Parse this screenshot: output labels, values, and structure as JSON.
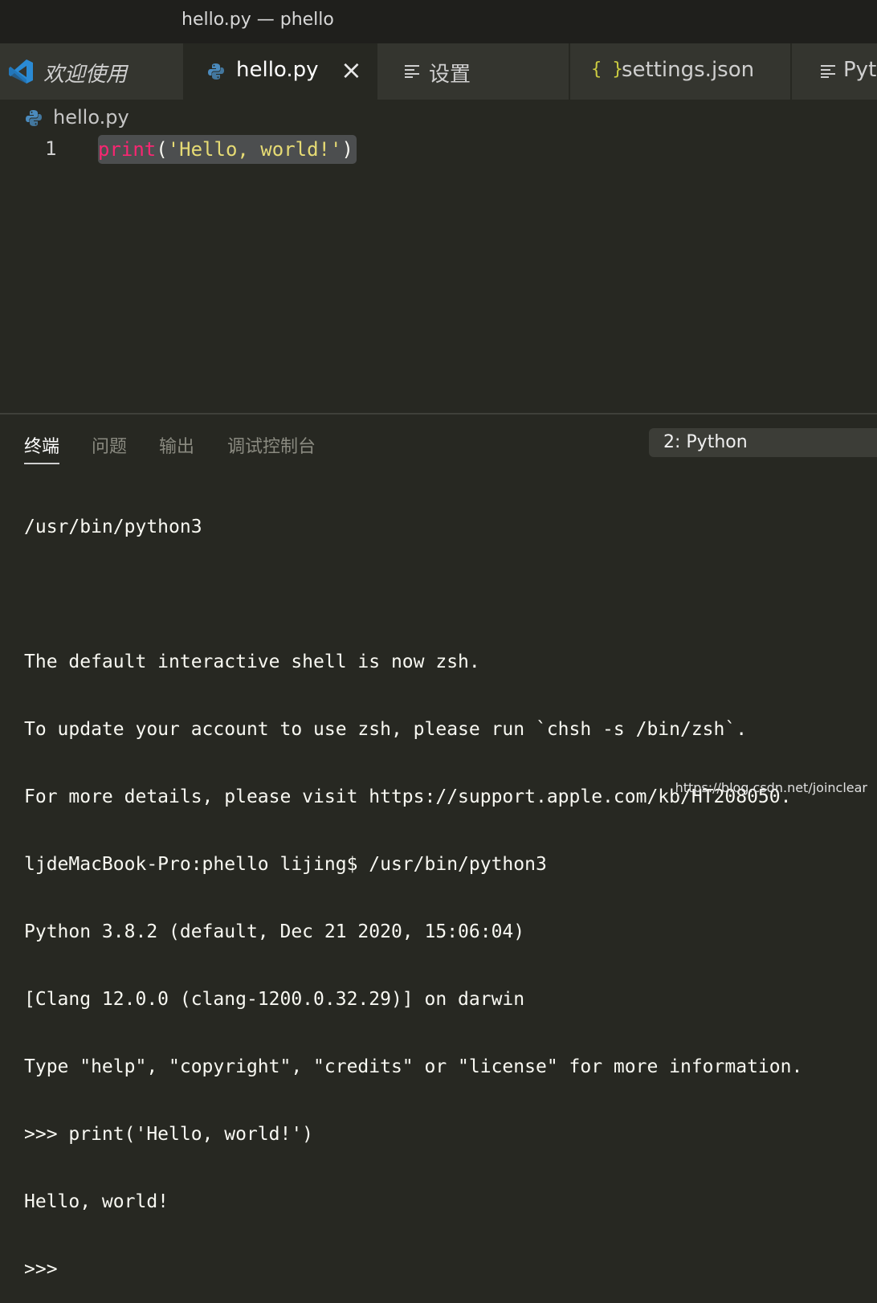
{
  "window": {
    "title": "hello.py — phello"
  },
  "tabs": [
    {
      "label": "欢迎使用",
      "icon": "vscode-logo-icon",
      "active": false
    },
    {
      "label": "hello.py",
      "icon": "python-file-icon",
      "active": true,
      "close": "×"
    },
    {
      "label": "设置",
      "icon": "settings-lines-icon",
      "active": false
    },
    {
      "label": "settings.json",
      "icon": "json-braces-icon",
      "icon_glyph": "{ }",
      "active": false
    },
    {
      "label": "Pyt",
      "icon": "settings-lines-icon",
      "active": false
    }
  ],
  "breadcrumb": {
    "file": "hello.py",
    "icon": "python-file-icon"
  },
  "editor": {
    "lines": [
      {
        "number": "1",
        "tokens": {
          "func": "print",
          "open": "(",
          "str": "'Hello, world!'",
          "close": ")"
        }
      }
    ]
  },
  "panel": {
    "tabs": [
      {
        "label": "终端",
        "active": true
      },
      {
        "label": "问题",
        "active": false
      },
      {
        "label": "输出",
        "active": false
      },
      {
        "label": "调试控制台",
        "active": false
      }
    ],
    "terminal_selector": "2: Python"
  },
  "terminal": {
    "lines": [
      "/usr/bin/python3",
      "",
      "The default interactive shell is now zsh.",
      "To update your account to use zsh, please run `chsh -s /bin/zsh`.",
      "For more details, please visit https://support.apple.com/kb/HT208050.",
      "ljdeMacBook-Pro:phello lijing$ /usr/bin/python3",
      "Python 3.8.2 (default, Dec 21 2020, 15:06:04)",
      "[Clang 12.0.0 (clang-1200.0.32.29)] on darwin",
      "Type \"help\", \"copyright\", \"credits\" or \"license\" for more information.",
      ">>> print('Hello, world!')",
      "Hello, world!",
      ">>> "
    ]
  },
  "watermark": "https://blog.csdn.net/joinclear",
  "colors": {
    "background": "#272822",
    "keyword": "#f92672",
    "string": "#e6db74",
    "vscode_blue": "#2a8ad4",
    "python_blue": "#4b8bbe",
    "json_yellow": "#cbcb41"
  }
}
